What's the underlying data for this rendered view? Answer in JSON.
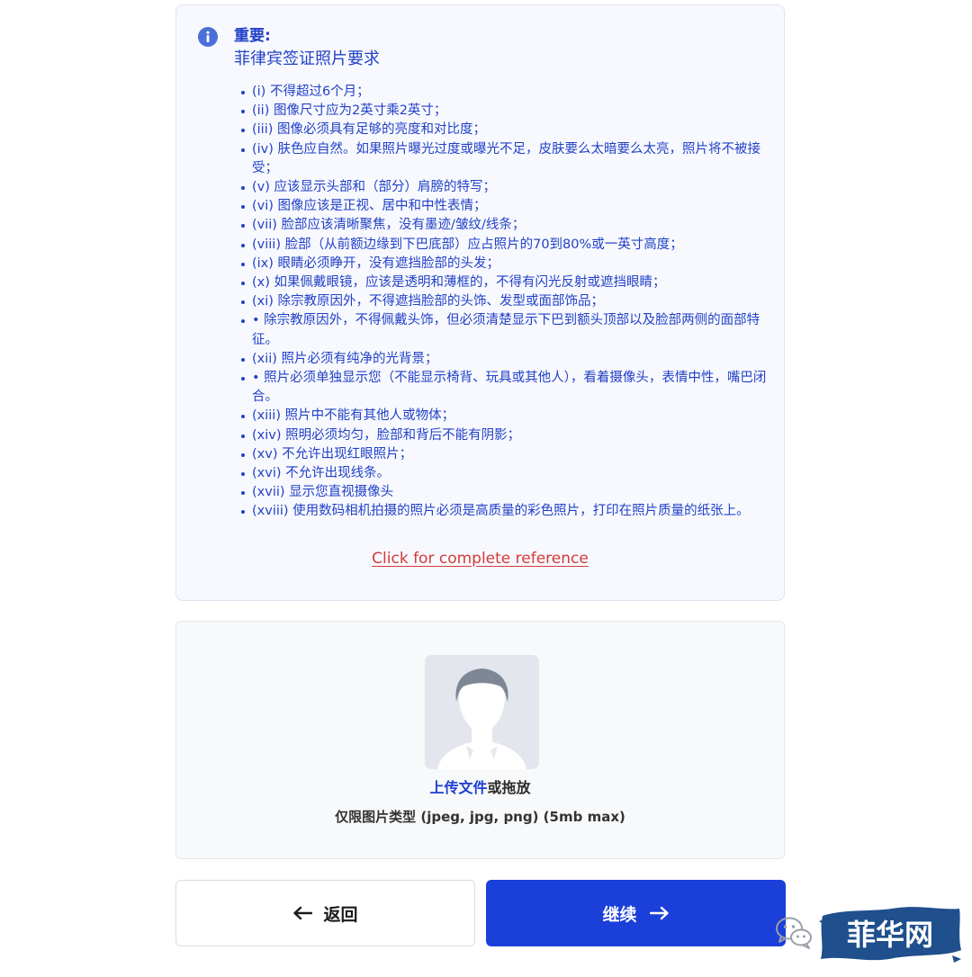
{
  "info": {
    "heading": "重要:",
    "subtitle": "菲律宾签证照片要求",
    "requirements": [
      "(i) 不得超过6个月；",
      "(ii) 图像尺寸应为2英寸乘2英寸；",
      "(iii) 图像必须具有足够的亮度和对比度；",
      "(iv) 肤色应自然。如果照片曝光过度或曝光不足，皮肤要么太暗要么太亮，照片将不被接受；",
      "(v) 应该显示头部和（部分）肩膀的特写；",
      "(vi) 图像应该是正视、居中和中性表情；",
      "(vii) 脸部应该清晰聚焦，没有墨迹/皱纹/线条；",
      "(viii) 脸部（从前额边缘到下巴底部）应占照片的70到80%或一英寸高度；",
      "(ix) 眼睛必须睁开，没有遮挡脸部的头发；",
      "(x) 如果佩戴眼镜，应该是透明和薄框的，不得有闪光反射或遮挡眼睛；",
      "(xi) 除宗教原因外，不得遮挡脸部的头饰、发型或面部饰品；",
      "• 除宗教原因外，不得佩戴头饰，但必须清楚显示下巴到额头顶部以及脸部两侧的面部特征。",
      "(xii) 照片必须有纯净的光背景；",
      "• 照片必须单独显示您（不能显示椅背、玩具或其他人），看着摄像头，表情中性，嘴巴闭合。",
      "(xiii) 照片中不能有其他人或物体；",
      "(xiv) 照明必须均匀，脸部和背后不能有阴影；",
      "(xv) 不允许出现红眼照片；",
      "(xvi) 不允许出现线条。",
      "(xvii) 显示您直视摄像头",
      "(xviii) 使用数码相机拍摄的照片必须是高质量的彩色照片，打印在照片质量的纸张上。"
    ],
    "reference_link": "Click for complete reference"
  },
  "upload": {
    "link_text": "上传文件",
    "suffix_text": "或拖放",
    "hint": "仅限图片类型 (jpeg, jpg, png) (5mb max)"
  },
  "buttons": {
    "back_label": "返回",
    "next_label": "继续"
  },
  "watermark": {
    "text": "菲华网"
  },
  "colors": {
    "accent_text": "#2141c8",
    "primary_button": "#1b3fd9",
    "link_red": "#d43a3a",
    "watermark_brush": "#1f4f8c"
  }
}
